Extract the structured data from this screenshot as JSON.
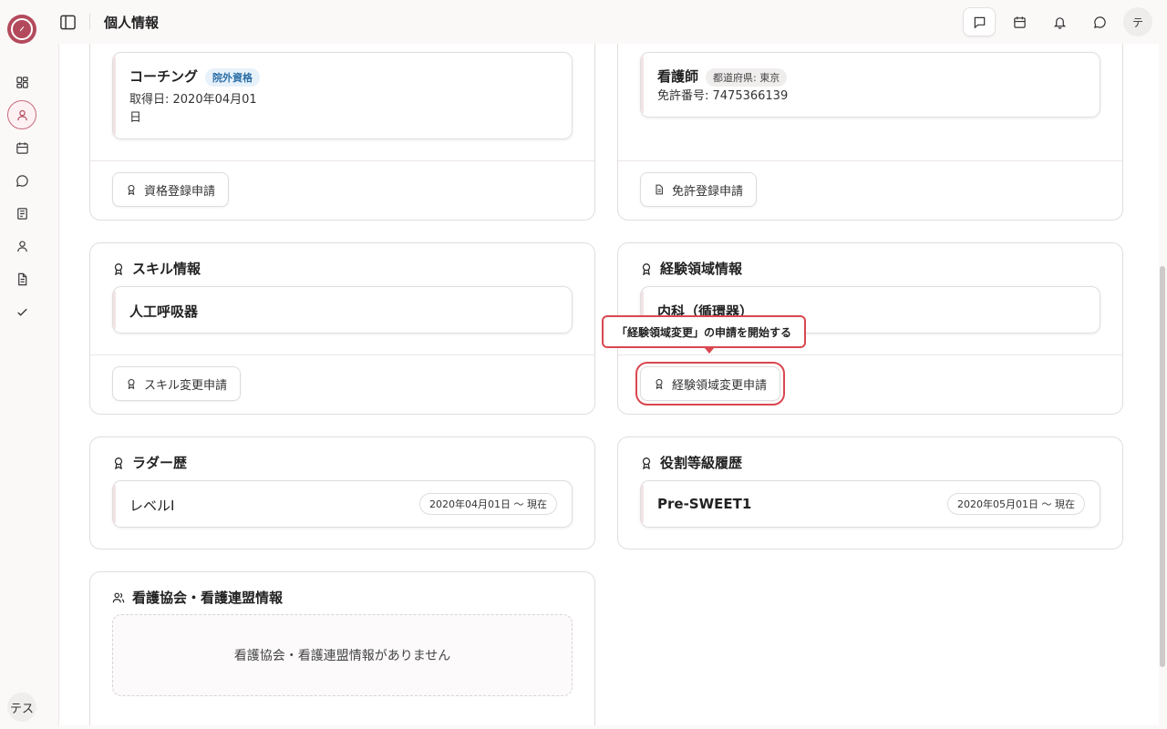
{
  "header": {
    "title": "個人情報",
    "avatar": "テ"
  },
  "rail": {
    "avatar": "テス"
  },
  "cards": {
    "qualification": {
      "item_name": "コーチング",
      "item_badge": "院外資格",
      "item_date_line1": "取得日: 2020年04月01",
      "item_date_line2": "日",
      "button": "資格登録申請"
    },
    "license": {
      "item_name": "看護師",
      "item_badge": "都道府県: 東京",
      "item_number": "免許番号: 7475366139",
      "button": "免許登録申請"
    },
    "skill": {
      "title": "スキル情報",
      "item_name": "人工呼吸器",
      "button": "スキル変更申請"
    },
    "experience": {
      "title": "経験領域情報",
      "item_name": "内科（循環器）",
      "button": "経験領域変更申請"
    },
    "ladder": {
      "title": "ラダー歴",
      "item_name": "レベルⅠ",
      "item_date": "2020年04月01日 〜 現在"
    },
    "role": {
      "title": "役割等級履歴",
      "item_name": "Pre-SWEET1",
      "item_date": "2020年05月01日 〜 現在"
    },
    "association": {
      "title": "看護協会・看護連盟情報",
      "empty_text": "看護協会・看護連盟情報がありません"
    }
  },
  "tooltip": {
    "text": "「経験領域変更」の申請を開始する"
  },
  "colors": {
    "brand": "#b34a5c",
    "highlight": "#d9474f",
    "badge_blue": "#2c6fa6"
  },
  "icons": {
    "rail": [
      "dashboard-icon",
      "user-icon",
      "calendar-icon",
      "chat-icon",
      "book-icon",
      "person-icon",
      "document-icon",
      "check-icon"
    ],
    "header": [
      "message-square-icon",
      "calendar-icon",
      "bell-icon",
      "chat-bubble-icon"
    ]
  }
}
